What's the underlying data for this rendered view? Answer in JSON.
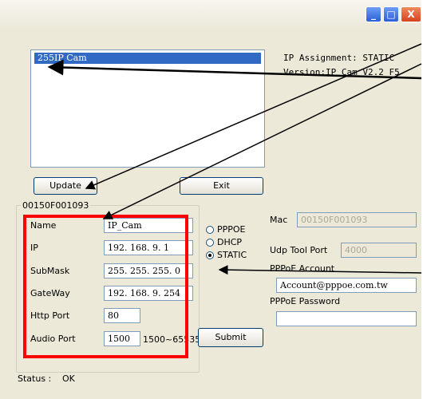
{
  "list": {
    "selected_item": "255IP Cam"
  },
  "info": {
    "ip_assignment": "IP Assignment: STATIC",
    "version": "Version:IP Cam V2.2_F5"
  },
  "buttons": {
    "update": "Update",
    "exit": "Exit",
    "submit": "Submit"
  },
  "device": {
    "group_title": "00150F001093",
    "fields": {
      "name": {
        "label": "Name",
        "value": "IP_Cam"
      },
      "ip": {
        "label": "IP",
        "value": "192. 168. 9. 1"
      },
      "submask": {
        "label": "SubMask",
        "value": "255. 255. 255. 0"
      },
      "gateway": {
        "label": "GateWay",
        "value": "192. 168. 9. 254"
      },
      "http_port": {
        "label": "Http Port",
        "value": "80"
      },
      "audio_port": {
        "label": "Audio Port",
        "value": "1500",
        "range": "1500~65535"
      }
    }
  },
  "mode": {
    "options": [
      "PPPOE",
      "DHCP",
      "STATIC"
    ],
    "selected": "STATIC"
  },
  "right": {
    "mac_label": "Mac",
    "mac_value": "00150F001093",
    "udp_label": "Udp Tool Port",
    "udp_value": "4000",
    "pppoe_account_label": "PPPoE Account",
    "pppoe_account_value": "Account@pppoe.com.tw",
    "pppoe_password_label": "PPPoE Password",
    "pppoe_password_value": ""
  },
  "status": {
    "label": "Status :",
    "value": "OK"
  },
  "colors": {
    "selection": "#316ac5",
    "highlight_box": "#ff0000",
    "window_bg": "#ece9d8"
  }
}
